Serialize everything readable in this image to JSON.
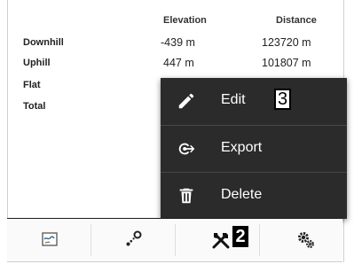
{
  "stats": {
    "columns": {
      "elevation": "Elevation",
      "distance": "Distance"
    },
    "rows": [
      {
        "label": "Downhill",
        "elevation": "-439 m",
        "distance": "123720 m"
      },
      {
        "label": "Uphill",
        "elevation": "447 m",
        "distance": "101807 m"
      },
      {
        "label": "Flat",
        "elevation": "",
        "distance": ""
      },
      {
        "label": "Total",
        "elevation": "",
        "distance": ""
      }
    ]
  },
  "popup_menu": {
    "items": [
      {
        "label": "Edit",
        "icon": "pencil-icon"
      },
      {
        "label": "Export",
        "icon": "export-icon"
      },
      {
        "label": "Delete",
        "icon": "trash-icon"
      }
    ],
    "callout": "3"
  },
  "toolbar": {
    "items": [
      {
        "icon": "map-icon"
      },
      {
        "icon": "route-points-icon"
      },
      {
        "icon": "tools-icon"
      },
      {
        "icon": "settings-gears-icon"
      }
    ],
    "callout": "2"
  },
  "colors": {
    "menu_bg": "#2b2b2b",
    "menu_text": "#ffffff",
    "toolbar_line": "#1a1a1a"
  }
}
